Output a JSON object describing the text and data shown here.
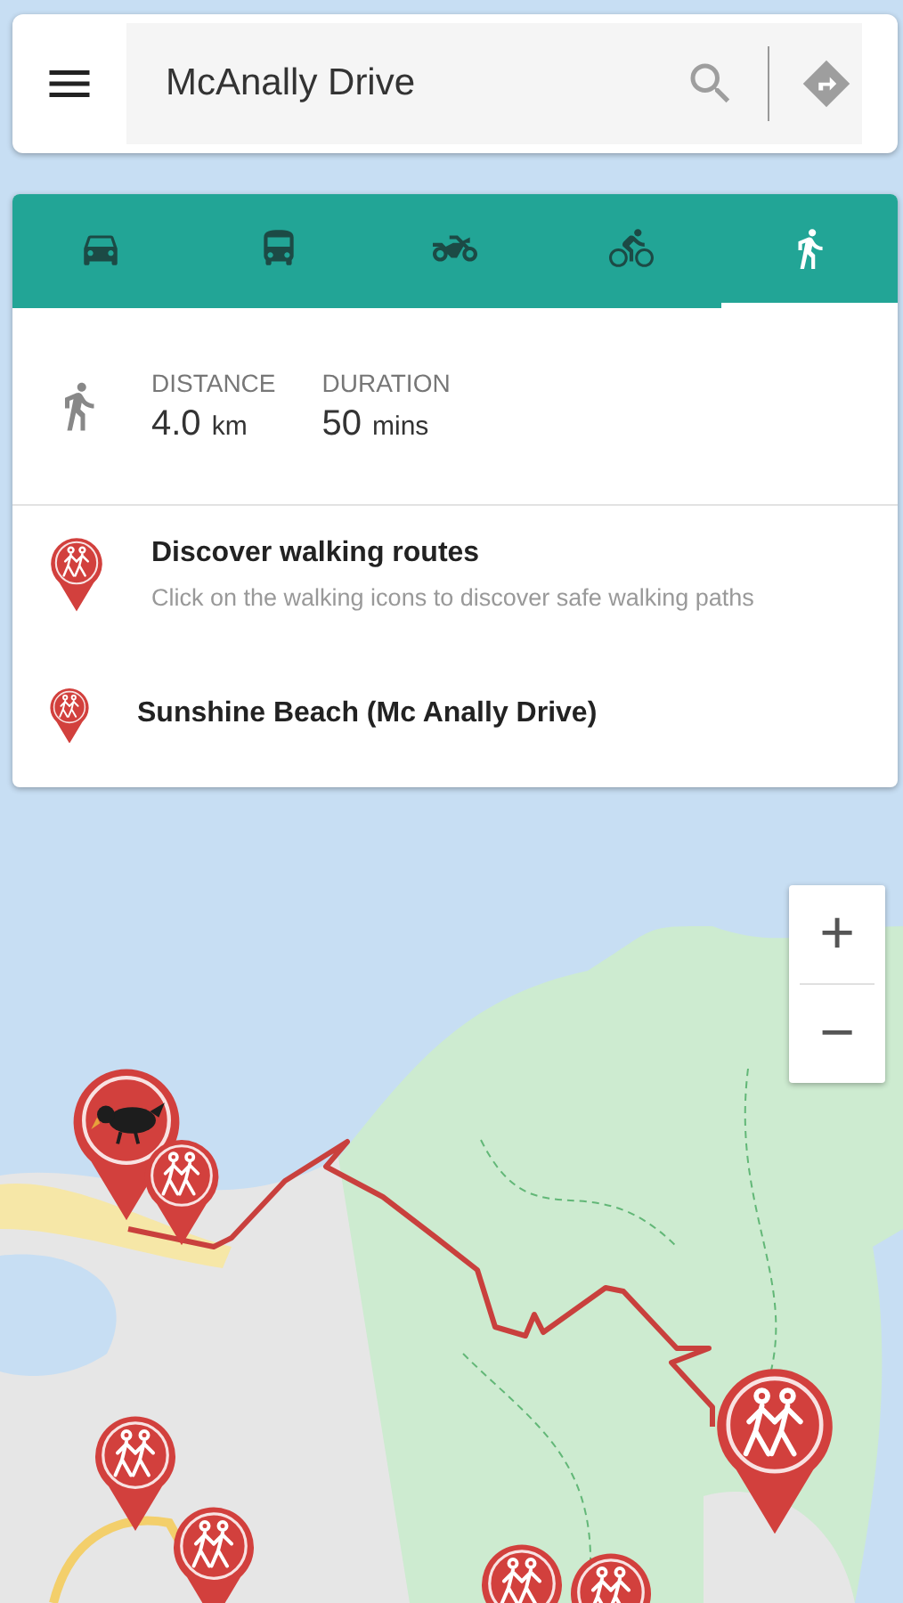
{
  "search": {
    "value": "McAnally Drive"
  },
  "modes": [
    {
      "kind": "car",
      "selected": false
    },
    {
      "kind": "bus",
      "selected": false
    },
    {
      "kind": "motorbike",
      "selected": false
    },
    {
      "kind": "bike",
      "selected": false
    },
    {
      "kind": "walk",
      "selected": true
    }
  ],
  "summary": {
    "stats": [
      {
        "label": "DISTANCE",
        "value": "4.0",
        "unit": "km"
      },
      {
        "label": "DURATION",
        "value": "50",
        "unit": "mins"
      }
    ]
  },
  "places": [
    {
      "title": "Discover walking routes",
      "subtitle": "Click on the walking icons to discover safe walking paths"
    },
    {
      "title": "Sunshine Beach (Mc Anally Drive)"
    }
  ],
  "map": {
    "zoom": {
      "in": "+",
      "out": "−"
    },
    "markers": [
      {
        "kind": "bird"
      },
      {
        "kind": "walk"
      },
      {
        "kind": "walk"
      },
      {
        "kind": "walk"
      },
      {
        "kind": "walk"
      },
      {
        "kind": "walk"
      },
      {
        "kind": "walk"
      }
    ]
  }
}
